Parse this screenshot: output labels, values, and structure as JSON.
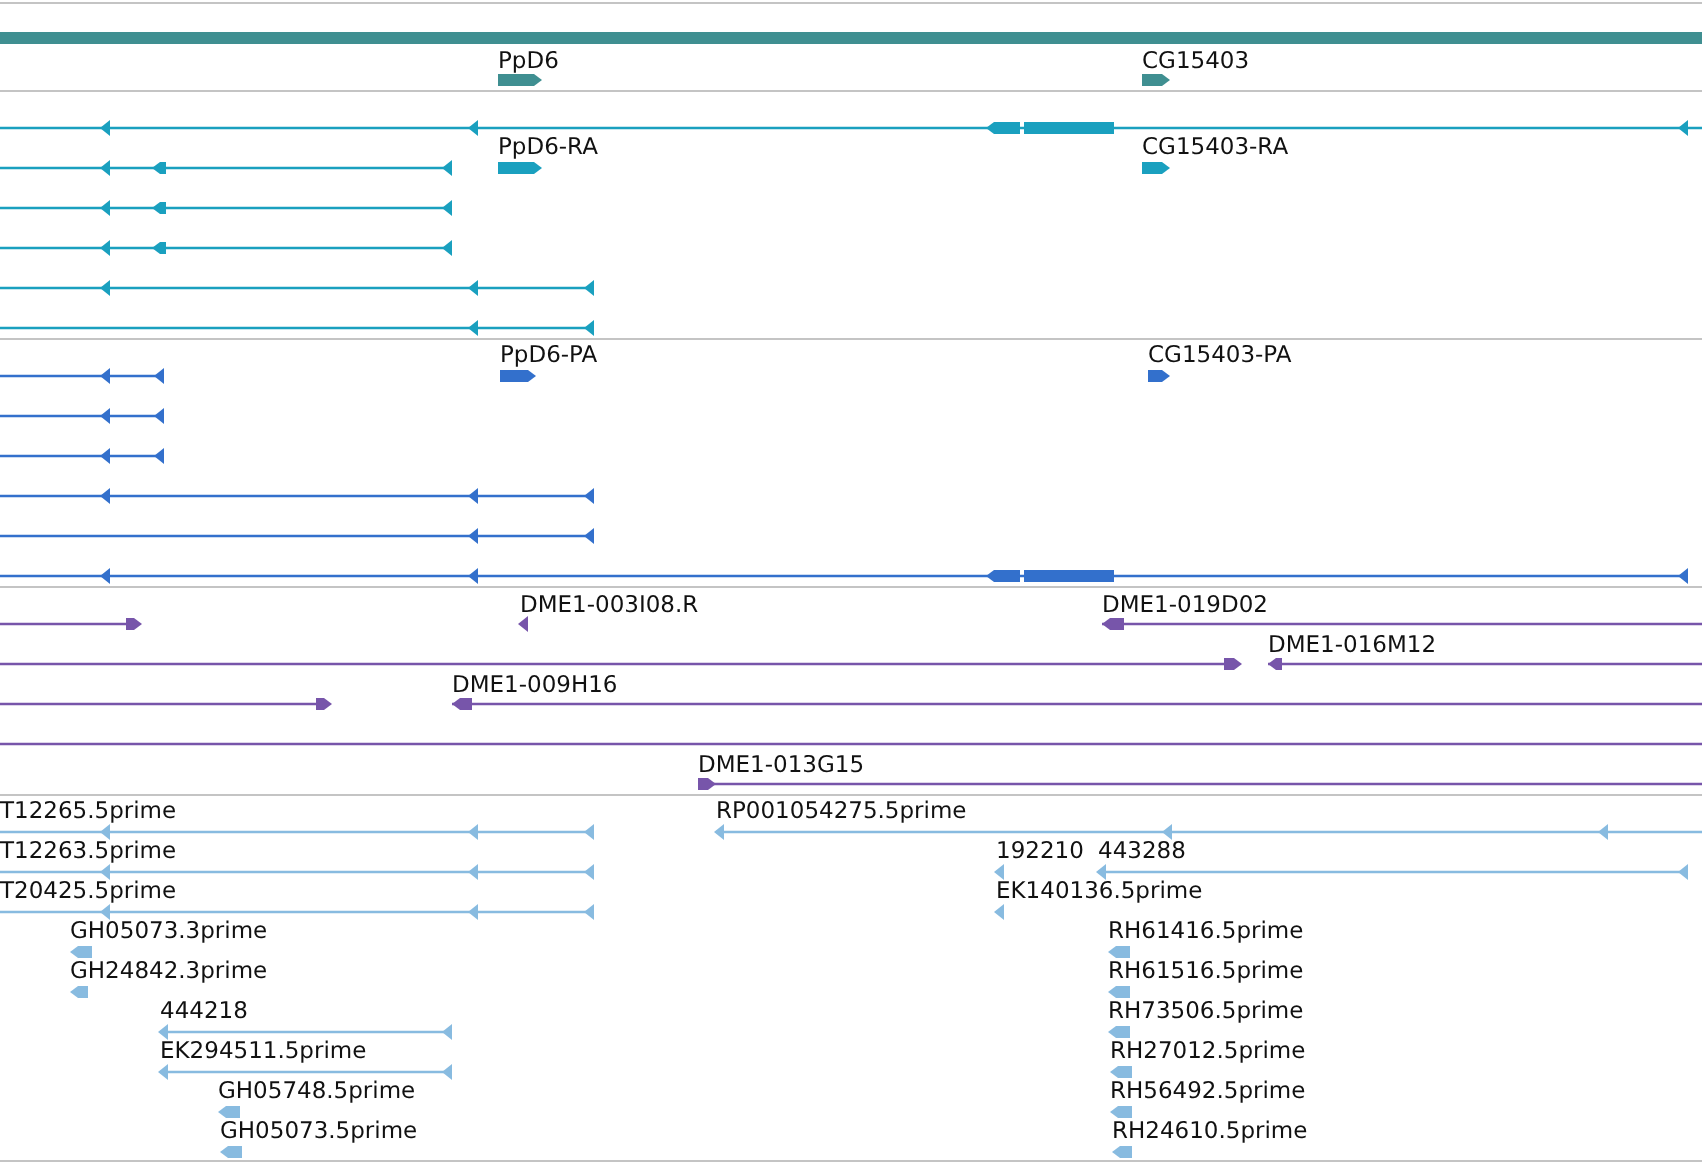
{
  "tracks": [
    {
      "color": "#3f8f91",
      "labels": [
        "PpD6",
        "CG15403"
      ]
    },
    {
      "color": "#1aa0bf",
      "labels": [
        "PpD6-RA",
        "CG15403-RA"
      ]
    },
    {
      "color": "#3370cc",
      "labels": [
        "PpD6-PA",
        "CG15403-PA"
      ]
    },
    {
      "color": "#7755aa",
      "labels": [
        "DME1-003I08.R",
        "DME1-019D02",
        "DME1-016M12",
        "DME1-009H16",
        "DME1-013G15"
      ]
    },
    {
      "color": "#88bbe0",
      "labels": [
        "T12265.5prime",
        "RP001054275.5prime",
        "T12263.5prime",
        "192210",
        "443288",
        "T20425.5prime",
        "EK140136.5prime",
        "GH05073.3prime",
        "RH61416.5prime",
        "GH24842.3prime",
        "RH61516.5prime",
        "444218",
        "RH73506.5prime",
        "EK294511.5prime",
        "RH27012.5prime",
        "GH05748.5prime",
        "RH56492.5prime",
        "GH05073.5prime",
        "RH24610.5prime"
      ]
    }
  ]
}
